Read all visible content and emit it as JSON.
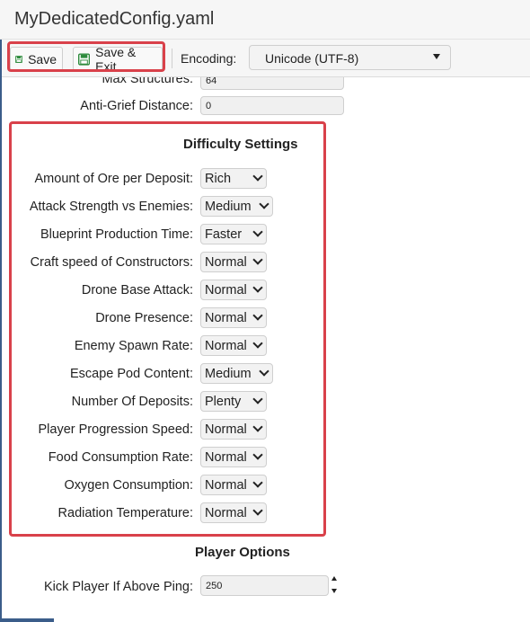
{
  "window": {
    "title": "MyDedicatedConfig.yaml"
  },
  "toolbar": {
    "save_label": "Save",
    "save_exit_label": "Save & Exit",
    "encoding_label": "Encoding:",
    "encoding_value": "Unicode (UTF-8)"
  },
  "fields_above": [
    {
      "label": "Max Structures:",
      "value": "64"
    },
    {
      "label": "Anti-Grief Distance:",
      "value": "0"
    }
  ],
  "difficulty": {
    "title": "Difficulty Settings",
    "rows": [
      {
        "label": "Amount of Ore per Deposit:",
        "value": "Rich"
      },
      {
        "label": "Attack Strength vs Enemies:",
        "value": "Medium"
      },
      {
        "label": "Blueprint Production Time:",
        "value": "Faster"
      },
      {
        "label": "Craft speed of Constructors:",
        "value": "Normal"
      },
      {
        "label": "Drone Base Attack:",
        "value": "Normal"
      },
      {
        "label": "Drone Presence:",
        "value": "Normal"
      },
      {
        "label": "Enemy Spawn Rate:",
        "value": "Normal"
      },
      {
        "label": "Escape Pod Content:",
        "value": "Medium"
      },
      {
        "label": "Number Of Deposits:",
        "value": "Plenty"
      },
      {
        "label": "Player Progression Speed:",
        "value": "Normal"
      },
      {
        "label": "Food Consumption Rate:",
        "value": "Normal"
      },
      {
        "label": "Oxygen Consumption:",
        "value": "Normal"
      },
      {
        "label": "Radiation Temperature:",
        "value": "Normal"
      }
    ]
  },
  "player_options": {
    "title": "Player Options",
    "kick_label": "Kick Player If Above Ping:",
    "kick_value": "250"
  },
  "colors": {
    "highlight": "#d9414a",
    "save_icon": "#2e8b3d",
    "frame_accent": "#3b5d8a"
  }
}
